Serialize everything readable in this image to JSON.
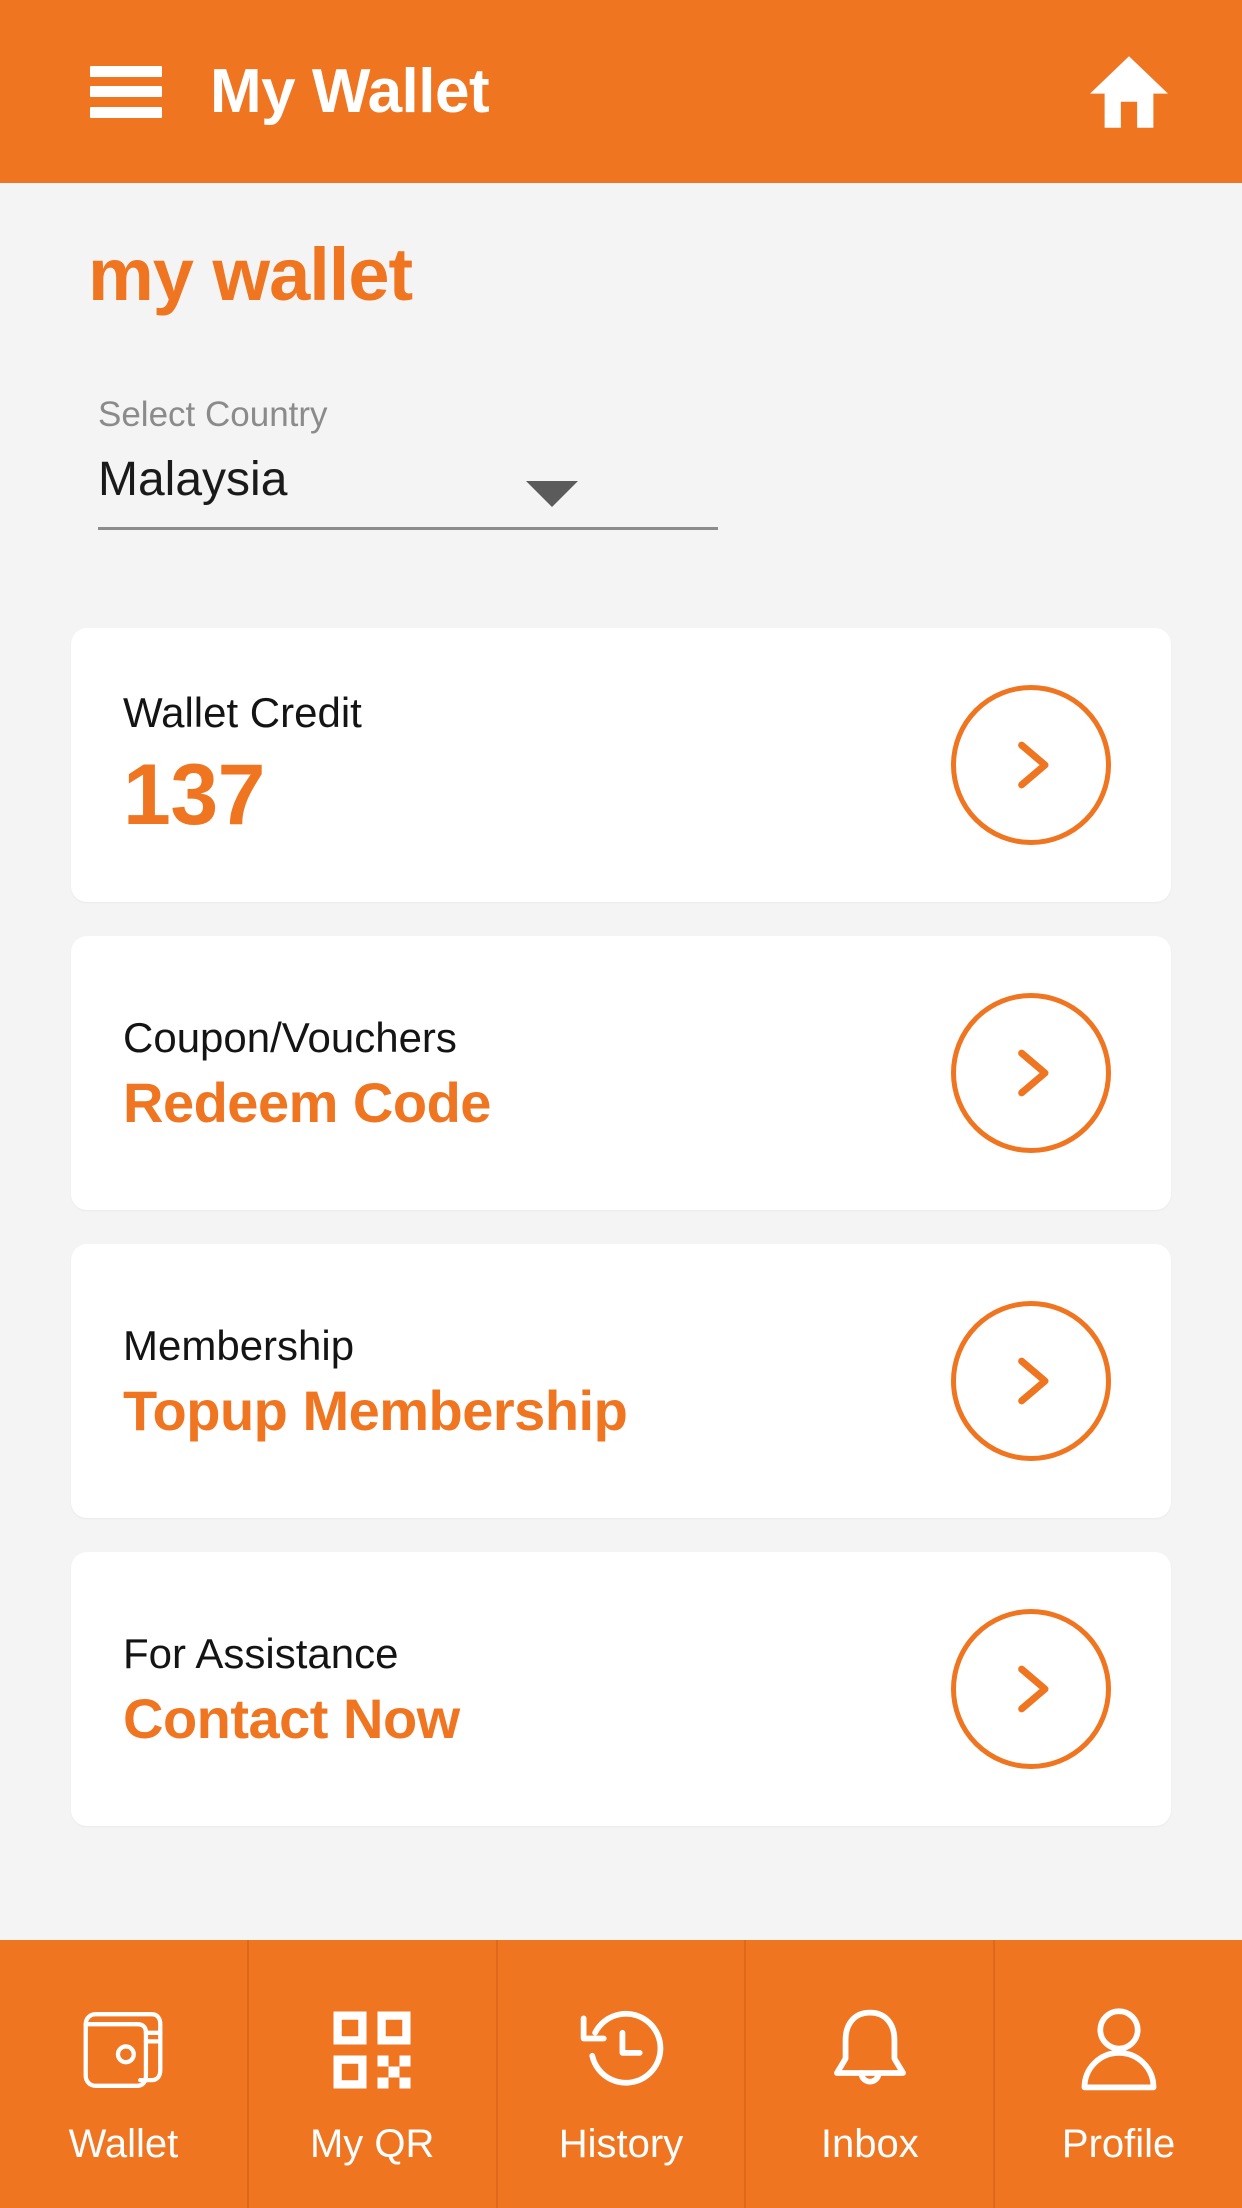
{
  "appbar": {
    "menu_icon": "hamburger-menu-icon",
    "title": "My Wallet",
    "home_icon": "home-icon"
  },
  "page": {
    "title": "my wallet",
    "background_color": "#f4f4f4",
    "accent_color": "#ef7521"
  },
  "country_select": {
    "label": "Select Country",
    "value": "Malaysia",
    "caret_icon": "chevron-down-icon"
  },
  "cards": [
    {
      "caption": "Wallet Credit",
      "value": "137",
      "value_size": "big",
      "arrow_icon": "chevron-right-circle-icon"
    },
    {
      "caption": "Coupon/Vouchers",
      "value": "Redeem Code",
      "value_size": "normal",
      "arrow_icon": "chevron-right-circle-icon"
    },
    {
      "caption": "Membership",
      "value": "Topup Membership",
      "value_size": "normal",
      "arrow_icon": "chevron-right-circle-icon"
    },
    {
      "caption": "For Assistance",
      "value": "Contact Now",
      "value_size": "normal",
      "arrow_icon": "chevron-right-circle-icon"
    }
  ],
  "bottom_nav": [
    {
      "label": "Wallet",
      "icon": "wallet-icon"
    },
    {
      "label": "My QR",
      "icon": "qr-code-icon"
    },
    {
      "label": "History",
      "icon": "history-clock-icon"
    },
    {
      "label": "Inbox",
      "icon": "bell-icon"
    },
    {
      "label": "Profile",
      "icon": "person-icon"
    }
  ]
}
